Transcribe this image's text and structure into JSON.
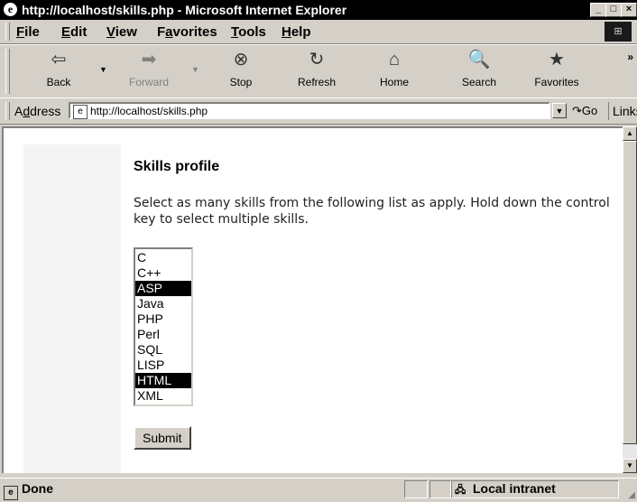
{
  "window": {
    "title": "http://localhost/skills.php - Microsoft Internet Explorer",
    "controls": [
      "_",
      "□",
      "×"
    ]
  },
  "menu": {
    "items": [
      {
        "label": "File",
        "accel": "F",
        "rest": "ile"
      },
      {
        "label": "Edit",
        "accel": "E",
        "rest": "dit"
      },
      {
        "label": "View",
        "accel": "V",
        "rest": "iew"
      },
      {
        "label": "Favorites",
        "accel": "a",
        "pre": "F",
        "rest": "vorites"
      },
      {
        "label": "Tools",
        "accel": "T",
        "rest": "ools"
      },
      {
        "label": "Help",
        "accel": "H",
        "rest": "elp"
      }
    ]
  },
  "toolbar": {
    "back": {
      "label": "Back",
      "icon": "back-arrow-icon",
      "glyph": "⇦"
    },
    "forward": {
      "label": "Forward",
      "icon": "forward-arrow-icon",
      "glyph": "➡"
    },
    "stop": {
      "label": "Stop",
      "icon": "stop-icon",
      "glyph": "⊗"
    },
    "refresh": {
      "label": "Refresh",
      "icon": "refresh-icon",
      "glyph": "↻"
    },
    "home": {
      "label": "Home",
      "icon": "home-icon",
      "glyph": "⌂"
    },
    "search": {
      "label": "Search",
      "icon": "search-icon",
      "glyph": "🔍"
    },
    "favorites": {
      "label": "Favorites",
      "icon": "favorites-icon",
      "glyph": "★"
    },
    "more": "»"
  },
  "address": {
    "label": "Address",
    "accel": "d",
    "url": "http://localhost/skills.php",
    "go": "Go",
    "links": "Links"
  },
  "page": {
    "heading": "Skills profile",
    "instructions": "Select as many skills from the following list as apply. Hold down the control key to select multiple skills.",
    "skills": [
      {
        "label": "C",
        "selected": false
      },
      {
        "label": "C++",
        "selected": false
      },
      {
        "label": "ASP",
        "selected": true
      },
      {
        "label": "Java",
        "selected": false
      },
      {
        "label": "PHP",
        "selected": false
      },
      {
        "label": "Perl",
        "selected": false
      },
      {
        "label": "SQL",
        "selected": false
      },
      {
        "label": "LISP",
        "selected": false
      },
      {
        "label": "HTML",
        "selected": true
      },
      {
        "label": "XML",
        "selected": false
      }
    ],
    "submit": "Submit"
  },
  "status": {
    "text": "Done",
    "zone": "Local intranet"
  }
}
